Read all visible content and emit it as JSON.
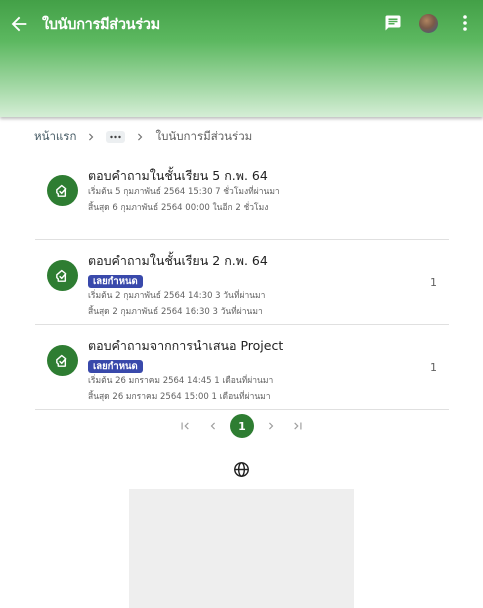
{
  "appbar": {
    "title": "ใบนับการมีส่วนร่วม"
  },
  "breadcrumb": {
    "home": "หน้าแรก",
    "current": "ใบนับการมีส่วนร่วม"
  },
  "items": [
    {
      "title": "ตอบคำถามในชั้นเรียน 5 ก.พ. 64",
      "badge": "",
      "start": "เริ่มต้น 5 กุมภาพันธ์ 2564 15:30 7 ชั่วโมงที่ผ่านมา",
      "end": "สิ้นสุด 6 กุมภาพันธ์ 2564 00:00 ในอีก 2 ชั่วโมง",
      "count": ""
    },
    {
      "title": "ตอบคำถามในชั้นเรียน 2 ก.พ. 64",
      "badge": "เลยกำหนด",
      "start": "เริ่มต้น 2 กุมภาพันธ์ 2564 14:30 3 วันที่ผ่านมา",
      "end": "สิ้นสุด 2 กุมภาพันธ์ 2564 16:30 3 วันที่ผ่านมา",
      "count": "1"
    },
    {
      "title": "ตอบคำถามจากการนำเสนอ Project",
      "badge": "เลยกำหนด",
      "start": "เริ่มต้น 26 มกราคม 2564 14:45 1 เดือนที่ผ่านมา",
      "end": "สิ้นสุด 26 มกราคม 2564 15:00 1 เดือนที่ผ่านมา",
      "count": "1"
    }
  ],
  "pagination": {
    "current_page": "1"
  },
  "icons": {
    "back": "arrow-left-icon",
    "chat": "chat-icon",
    "more": "more-vert-icon",
    "item": "hand-raise-icon",
    "globe": "globe-icon"
  },
  "colors": {
    "primary": "#43a047",
    "icon_bg": "#2e7d32",
    "badge": "#3949ab"
  }
}
